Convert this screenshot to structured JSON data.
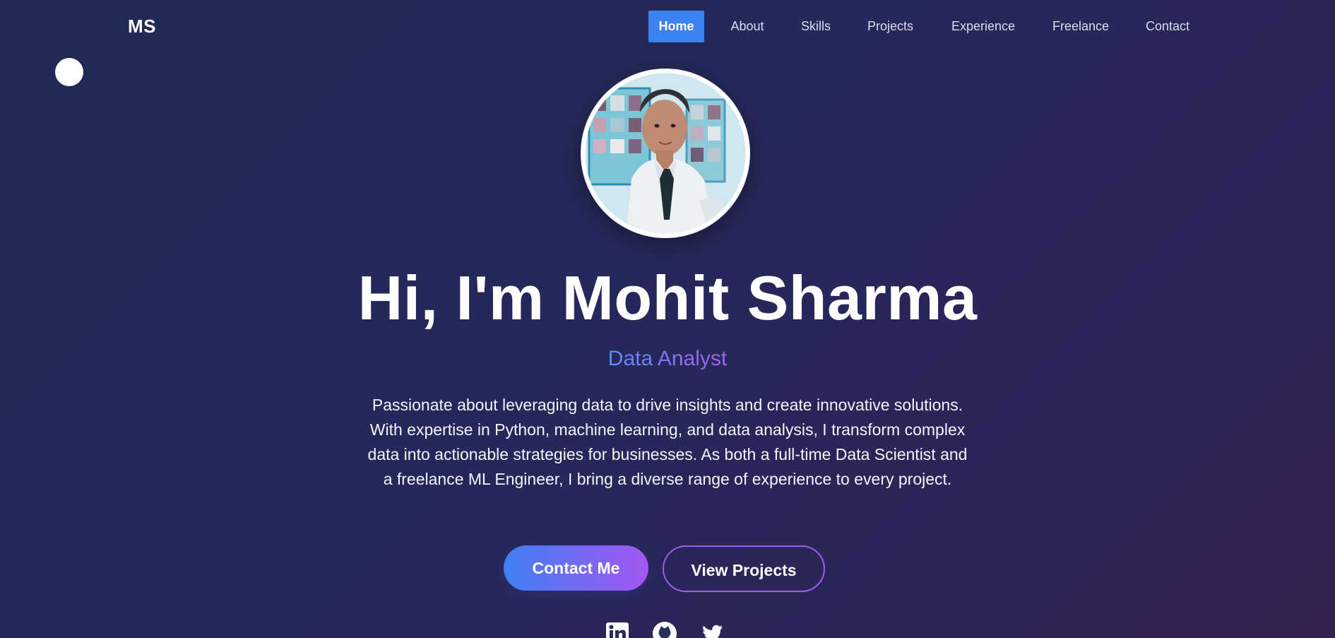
{
  "brand": {
    "logo": "MS"
  },
  "nav": {
    "items": [
      {
        "label": "Home",
        "active": true
      },
      {
        "label": "About",
        "active": false
      },
      {
        "label": "Skills",
        "active": false
      },
      {
        "label": "Projects",
        "active": false
      },
      {
        "label": "Experience",
        "active": false
      },
      {
        "label": "Freelance",
        "active": false
      },
      {
        "label": "Contact",
        "active": false
      }
    ]
  },
  "hero": {
    "title": "Hi, I'm Mohit Sharma",
    "subtitle": "Data Analyst",
    "description": "Passionate about leveraging data to drive insights and create innovative solutions. With expertise in Python, machine learning, and data analysis, I transform complex data into actionable strategies for businesses. As both a full-time Data Scientist and a freelance ML Engineer, I bring a diverse range of experience to every project.",
    "primary_button": "Contact Me",
    "secondary_button": "View Projects"
  },
  "socials": [
    {
      "icon": "linkedin-icon"
    },
    {
      "icon": "github-icon"
    },
    {
      "icon": "twitter-icon"
    }
  ],
  "colors": {
    "accent_blue": "#3d82f5",
    "accent_purple": "#a457f1",
    "background_start": "#1f2a55",
    "background_end": "#35214f"
  }
}
